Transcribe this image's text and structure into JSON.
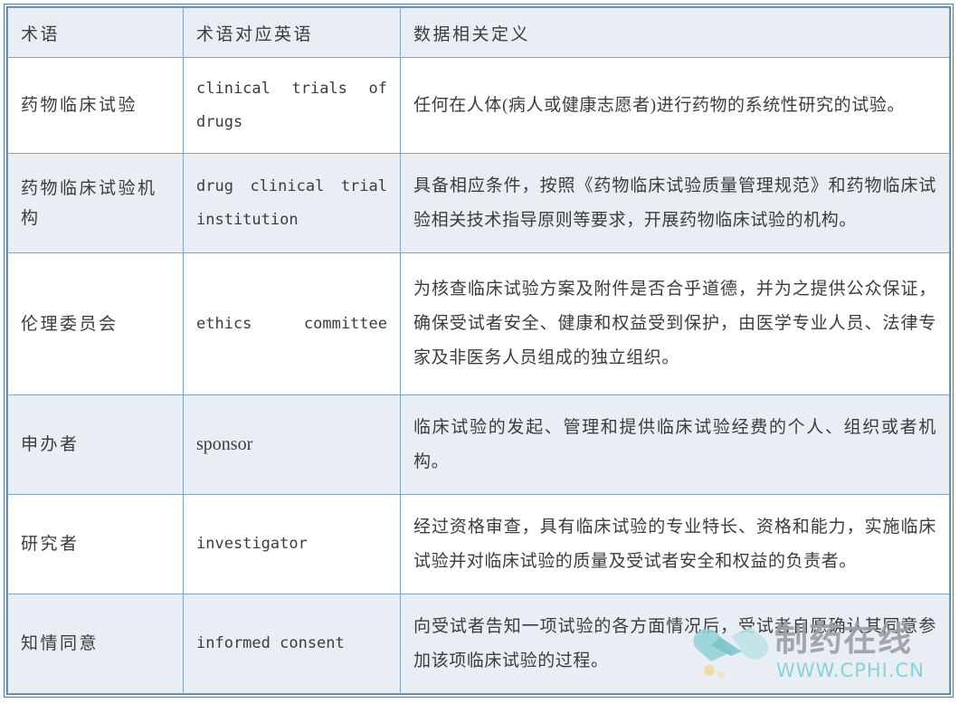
{
  "table": {
    "columns": [
      {
        "id": "term",
        "header": "术语"
      },
      {
        "id": "english",
        "header": "术语对应英语"
      },
      {
        "id": "definition",
        "header": "数据相关定义"
      }
    ],
    "rows": [
      {
        "term": "药物临床试验",
        "english": "clinical trials of drugs",
        "definition": "任何在人体(病人或健康志愿者)进行药物的系统性研究的试验。",
        "shaded": false,
        "english_style": "mono"
      },
      {
        "term": "药物临床试验机构",
        "english": "drug clinical trial institution",
        "definition": "具备相应条件，按照《药物临床试验质量管理规范》和药物临床试验相关技术指导原则等要求，开展药物临床试验的机构。",
        "shaded": true,
        "english_style": "mono"
      },
      {
        "term": "伦理委员会",
        "english": "ethics committee",
        "definition": "为核查临床试验方案及附件是否合乎道德，并为之提供公众保证，确保受试者安全、健康和权益受到保护，由医学专业人员、法律专家及非医务人员组成的独立组织。",
        "shaded": false,
        "english_style": "mono"
      },
      {
        "term": "申办者",
        "english": "sponsor",
        "definition": "临床试验的发起、管理和提供临床试验经费的个人、组织或者机构。",
        "shaded": true,
        "english_style": "serif"
      },
      {
        "term": "研究者",
        "english": "investigator",
        "definition": "经过资格审查，具有临床试验的专业特长、资格和能力，实施临床试验并对临床试验的质量及受试者安全和权益的负责者。",
        "shaded": false,
        "english_style": "mono-left"
      },
      {
        "term": "知情同意",
        "english": "informed consent",
        "definition": "向受试者告知一项试验的各方面情况后，受试者自愿确认其同意参加该项临床试验的过程。",
        "shaded": true,
        "english_style": "mono-left"
      }
    ]
  },
  "watermark": {
    "brand": "制药在线",
    "url": "WWW.CPHI.CN",
    "logo_icon": "capsule-pill-icon",
    "brand_color": "#9aa2a6",
    "url_color": "#7fd0d8",
    "capsule_color": "#7fc8cc"
  },
  "theme": {
    "border_color": "#7ba3c8",
    "frame_color": "#4a7aa7",
    "shaded_row_bg": "#e9eef5",
    "plain_row_bg": "#ffffff",
    "text_color": "#3c3c3c"
  }
}
